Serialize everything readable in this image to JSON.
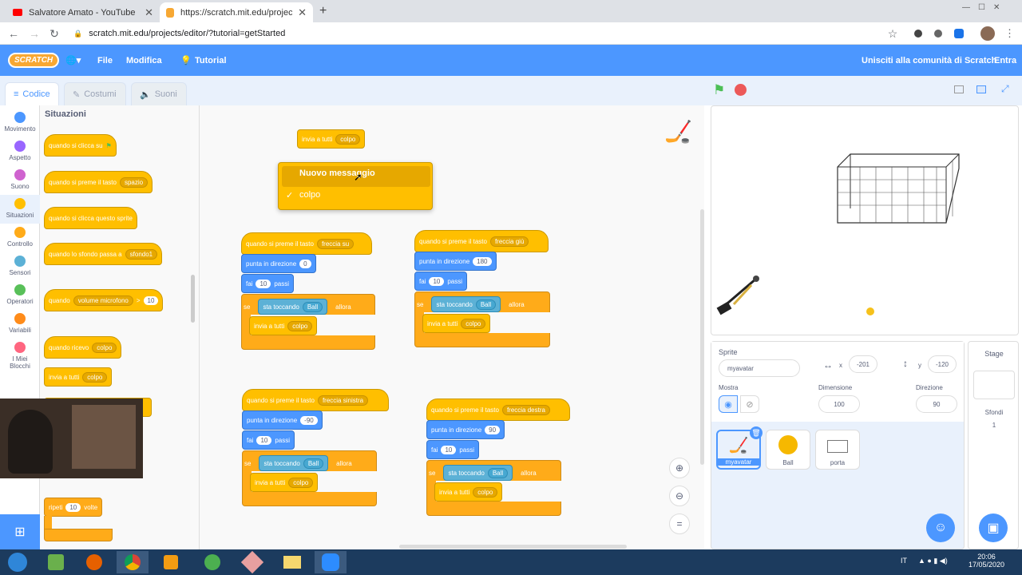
{
  "browser": {
    "tabs": [
      {
        "title": "Salvatore Amato - YouTube",
        "icon": "youtube-icon"
      },
      {
        "title": "https://scratch.mit.edu/projects/...",
        "icon": "scratch-favicon-icon"
      }
    ],
    "new_tab": "+",
    "url": "scratch.mit.edu/projects/editor/?tutorial=getStarted"
  },
  "menubar": {
    "logo": "SCRATCH",
    "file": "File",
    "edit": "Modifica",
    "tutorial": "Tutorial",
    "join": "Unisciti alla comunità di Scratch",
    "signin": "Entra"
  },
  "editor_tabs": [
    {
      "label": "Codice"
    },
    {
      "label": "Costumi"
    },
    {
      "label": "Suoni"
    }
  ],
  "categories": [
    {
      "label": "Movimento",
      "color": "#4c97ff"
    },
    {
      "label": "Aspetto",
      "color": "#9966ff"
    },
    {
      "label": "Suono",
      "color": "#cf63cf"
    },
    {
      "label": "Situazioni",
      "color": "#ffbf00"
    },
    {
      "label": "Controllo",
      "color": "#ffab19"
    },
    {
      "label": "Sensori",
      "color": "#5cb1d6"
    },
    {
      "label": "Operatori",
      "color": "#59c059"
    },
    {
      "label": "Variabili",
      "color": "#ff8c1a"
    },
    {
      "label": "I Miei Blocchi",
      "color": "#ff6680"
    }
  ],
  "palette": {
    "title": "Situazioni",
    "b1": "quando si clicca su",
    "b2": "quando si preme il tasto",
    "b2_key": "spazio",
    "b3": "quando si clicca questo sprite",
    "b4": "quando lo sfondo passa a",
    "b4_val": "sfondo1",
    "b5": "quando",
    "b5_dd": "volume microfono",
    "b5_op": ">",
    "b5_val": "10",
    "b6": "quando ricevo",
    "b6_val": "colpo",
    "b7": "invia a tutti",
    "b7_val": "colpo",
    "b8": "ripeti",
    "b8_val": "10",
    "b8_tail": "volte"
  },
  "workspace": {
    "top_block": "invia a tutti",
    "top_val": "colpo",
    "menu": {
      "new": "Nuovo messaggio",
      "check": "✓",
      "colpo": "colpo"
    },
    "scripts": [
      {
        "hat": "quando si preme il tasto",
        "key": "freccia su",
        "dir_label": "punta in direzione",
        "dir": "0",
        "move": "fai",
        "steps": "10",
        "steps_label": "passi",
        "if": "se",
        "touch": "sta toccando",
        "obj": "Ball",
        "then": "allora",
        "bcast": "invia a tutti",
        "msg": "colpo"
      },
      {
        "hat": "quando si preme il tasto",
        "key": "freccia giù",
        "dir_label": "punta in direzione",
        "dir": "180",
        "move": "fai",
        "steps": "10",
        "steps_label": "passi",
        "if": "se",
        "touch": "sta toccando",
        "obj": "Ball",
        "then": "allora",
        "bcast": "invia a tutti",
        "msg": "colpo"
      },
      {
        "hat": "quando si preme il tasto",
        "key": "freccia sinistra",
        "dir_label": "punta in direzione",
        "dir": "-90",
        "move": "fai",
        "steps": "10",
        "steps_label": "passi",
        "if": "se",
        "touch": "sta toccando",
        "obj": "Ball",
        "then": "allora",
        "bcast": "invia a tutti",
        "msg": "colpo"
      },
      {
        "hat": "quando si preme il tasto",
        "key": "freccia destra",
        "dir_label": "punta in direzione",
        "dir": "90",
        "move": "fai",
        "steps": "10",
        "steps_label": "passi",
        "if": "se",
        "touch": "sta toccando",
        "obj": "Ball",
        "then": "allora",
        "bcast": "invia a tutti",
        "msg": "colpo"
      }
    ]
  },
  "sprite": {
    "label": "Sprite",
    "name": "myavatar",
    "x_label": "x",
    "x": "-201",
    "y_label": "y",
    "y": "-120",
    "show": "Mostra",
    "size_label": "Dimensione",
    "size": "100",
    "dir_label": "Direzione",
    "dir": "90"
  },
  "sprites": [
    {
      "name": "myavatar"
    },
    {
      "name": "Ball"
    },
    {
      "name": "porta"
    }
  ],
  "stage_panel": {
    "title": "Stage",
    "backdrops": "Sfondi",
    "count": "1"
  },
  "taskbar": {
    "lang": "IT",
    "time": "20:06",
    "date": "17/05/2020"
  },
  "colors": {
    "scratch_blue": "#4c97ff",
    "events": "#ffbf00",
    "control": "#ffab19",
    "motion": "#4c97ff",
    "sensing": "#5cb1d6"
  }
}
